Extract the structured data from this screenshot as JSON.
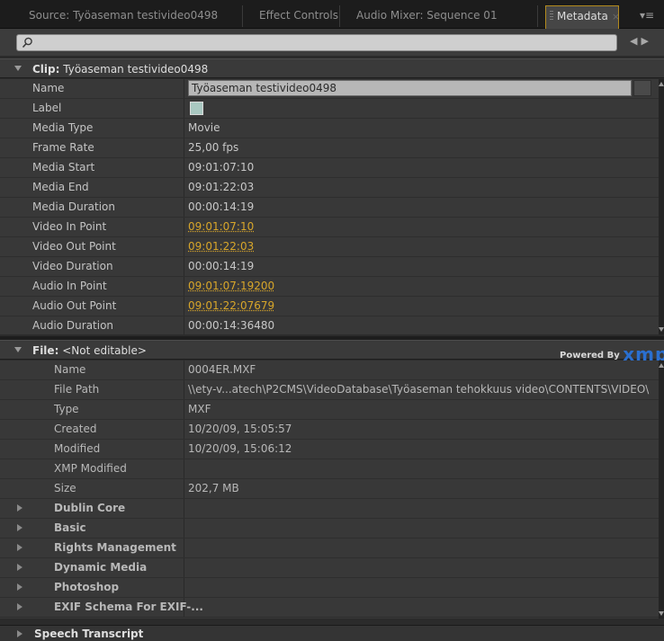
{
  "tabs": [
    {
      "label": "Source: Työaseman testivideo0498"
    },
    {
      "label": "Effect Controls"
    },
    {
      "label": "Audio Mixer: Sequence 01"
    },
    {
      "label": "Metadata"
    }
  ],
  "tab_close": "×",
  "panel_menu": "▾≡",
  "search": {
    "placeholder": ""
  },
  "nav": {
    "prev": "◀",
    "next": "▶"
  },
  "clip": {
    "heading_label": "Clip:",
    "heading_value": "Työaseman testivideo0498",
    "name_label": "Name",
    "name_value": "Työaseman testivideo0498",
    "label_label": "Label",
    "label_color": "#a9c8c1",
    "rows": [
      {
        "label": "Media Type",
        "value": "Movie"
      },
      {
        "label": "Frame Rate",
        "value": "25,00 fps"
      },
      {
        "label": "Media Start",
        "value": "09:01:07:10"
      },
      {
        "label": "Media End",
        "value": "09:01:22:03"
      },
      {
        "label": "Media Duration",
        "value": "00:00:14:19"
      },
      {
        "label": "Video In Point",
        "value": "09:01:07:10"
      },
      {
        "label": "Video Out Point",
        "value": "09:01:22:03"
      },
      {
        "label": "Video Duration",
        "value": "00:00:14:19"
      },
      {
        "label": "Audio In Point",
        "value": "09:01:07:19200"
      },
      {
        "label": "Audio Out Point",
        "value": "09:01:22:07679"
      },
      {
        "label": "Audio Duration",
        "value": "00:00:14:36480"
      }
    ]
  },
  "file": {
    "heading_label": "File:",
    "heading_value": "<Not editable>",
    "powered_by": "Powered By",
    "xmp": "xmp",
    "rows": [
      {
        "label": "Name",
        "value": "0004ER.MXF"
      },
      {
        "label": "File Path",
        "value": "\\\\ety-v...atech\\P2CMS\\VideoDatabase\\Työaseman tehokkuus video\\CONTENTS\\VIDEO\\"
      },
      {
        "label": "Type",
        "value": "MXF"
      },
      {
        "label": "Created",
        "value": "10/20/09, 15:05:57"
      },
      {
        "label": "Modified",
        "value": "10/20/09, 15:06:12"
      },
      {
        "label": "XMP Modified",
        "value": ""
      },
      {
        "label": "Size",
        "value": "202,7 MB"
      }
    ],
    "groups": [
      "Dublin Core",
      "Basic",
      "Rights Management",
      "Dynamic Media",
      "Photoshop",
      "EXIF Schema For EXIF-..."
    ]
  },
  "footer": {
    "label": "Speech Transcript"
  },
  "colors": {
    "accent": "#b28a1e",
    "link": "#d8a62a",
    "xmp_blue": "#2a6fd0"
  }
}
